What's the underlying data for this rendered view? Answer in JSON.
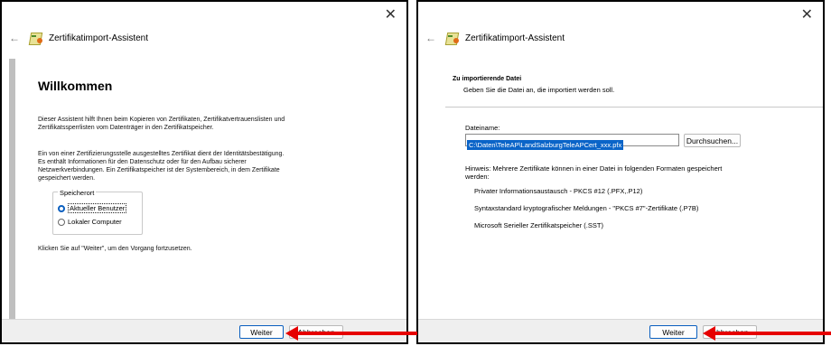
{
  "left_dialog": {
    "close_glyph": "✕",
    "back_glyph": "←",
    "title": "Zertifikatimport-Assistent",
    "heading": "Willkommen",
    "para1_line1": "Dieser Assistent hilft Ihnen beim Kopieren von Zertifikaten, Zertifikatvertrauenslisten und",
    "para1_line2": "Zertifikatssperrlisten vom Datenträger in den Zertifikatspeicher.",
    "para2_line1": "Ein von einer Zertifizierungsstelle ausgestelltes Zertifikat dient der Identitätsbestätigung.",
    "para2_line2": "Es enthält Informationen für den Datenschutz oder für den Aufbau sicherer",
    "para2_line3": "Netzwerkverbindungen. Ein Zertifikatspeicher ist der Systembereich, in dem Zertifikate",
    "para2_line4": "gespeichert werden.",
    "store_group_label": "Speicherort",
    "radio_current_user": "Aktueller Benutzer",
    "radio_local_machine": "Lokaler Computer",
    "continue_hint": "Klicken Sie auf \"Weiter\", um den Vorgang fortzusetzen.",
    "next_button": "Weiter",
    "cancel_button": "Abbrechen"
  },
  "right_dialog": {
    "close_glyph": "✕",
    "back_glyph": "←",
    "title": "Zertifikatimport-Assistent",
    "section_title": "Zu importierende Datei",
    "section_subtitle": "Geben Sie die Datei an, die importiert werden soll.",
    "filename_label": "Dateiname:",
    "filename_value": "C:\\Daten\\TeleAP\\LandSalzburgTeleAPCert_xxx.pfx",
    "browse_button": "Durchsuchen...",
    "hint_line1": "Hinweis: Mehrere Zertifikate können in einer Datei in folgenden Formaten gespeichert",
    "hint_line2": "werden:",
    "format_pfx": "Privater Informationsaustausch - PKCS #12 (.PFX,.P12)",
    "format_p7b": "Syntaxstandard kryptografischer Meldungen - \"PKCS #7\"-Zertifikate (.P7B)",
    "format_sst": "Microsoft Serieller Zertifikatspeicher (.SST)",
    "next_button": "Weiter",
    "cancel_button": "Abbrechen"
  },
  "colors": {
    "annotation_arrow": "#e60000",
    "accent": "#0a5fbf",
    "selection": "#0a64c8"
  },
  "icons": [
    "close-icon",
    "back-arrow-icon",
    "certificate-icon"
  ]
}
